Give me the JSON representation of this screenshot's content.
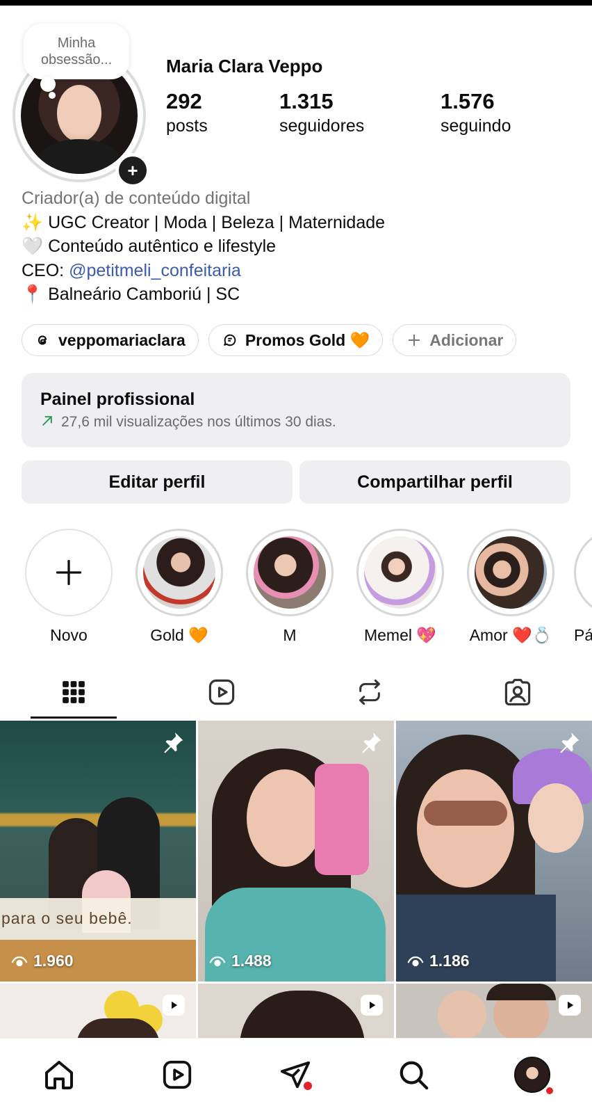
{
  "profile": {
    "note": "Minha obsessão...",
    "name": "Maria Clara Veppo",
    "stats": [
      {
        "value": "292",
        "label": "posts"
      },
      {
        "value": "1.315",
        "label": "seguidores"
      },
      {
        "value": "1.576",
        "label": "seguindo"
      }
    ],
    "bio": {
      "category": "Criador(a) de conteúdo digital",
      "line1": "✨ UGC Creator | Moda | Beleza | Maternidade",
      "line2": "🤍 Conteúdo autêntico e lifestyle",
      "line3_prefix": "CEO: ",
      "line3_link": "@petitmeli_confeitaria",
      "line4": "📍 Balneário Camboriú | SC"
    }
  },
  "chips": {
    "threads": "veppomariaclara",
    "promos": "Promos Gold 🧡",
    "add": "Adicionar"
  },
  "dashboard": {
    "title": "Painel profissional",
    "subtitle": "27,6 mil visualizações nos últimos 30 dias."
  },
  "buttons": {
    "edit": "Editar perfil",
    "share": "Compartilhar perfil"
  },
  "highlights": [
    {
      "label": "Novo"
    },
    {
      "label": "Gold 🧡"
    },
    {
      "label": "M"
    },
    {
      "label": "Memel 💖"
    },
    {
      "label": "Amor ❤️💍"
    },
    {
      "label": "Pá"
    }
  ],
  "grid": {
    "tiles": [
      {
        "views": "1.960",
        "caption": "para o seu bebê."
      },
      {
        "views": "1.488"
      },
      {
        "views": "1.186"
      }
    ]
  },
  "colors": {
    "link": "#3b5bb0",
    "notification_dot": "#e0242c",
    "trend_green": "#2c9a5a"
  }
}
